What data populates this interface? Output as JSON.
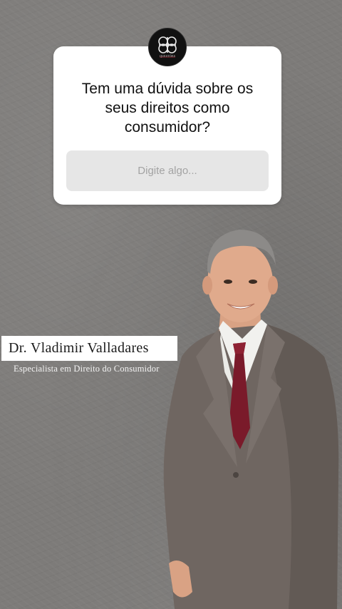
{
  "brand": {
    "logo_icon": "celtic-knot-emblem-icon",
    "logo_text": "QUESTÕES",
    "accent_color": "#7a1a2a"
  },
  "question_sticker": {
    "question": "Tem uma dúvida sobre os\nseus direitos como\nconsumidor?",
    "placeholder": "Digite algo..."
  },
  "lawyer": {
    "name": "Dr. Vladimir Valladares",
    "title": "Especialista em Direito do Consumidor",
    "photo_icon": "lawyer-portrait-photo"
  },
  "colors": {
    "background": "#7d7b79",
    "card": "#ffffff",
    "input_bg": "#e6e6e6",
    "suit": "#6f6661",
    "tie": "#7a1a2a"
  }
}
